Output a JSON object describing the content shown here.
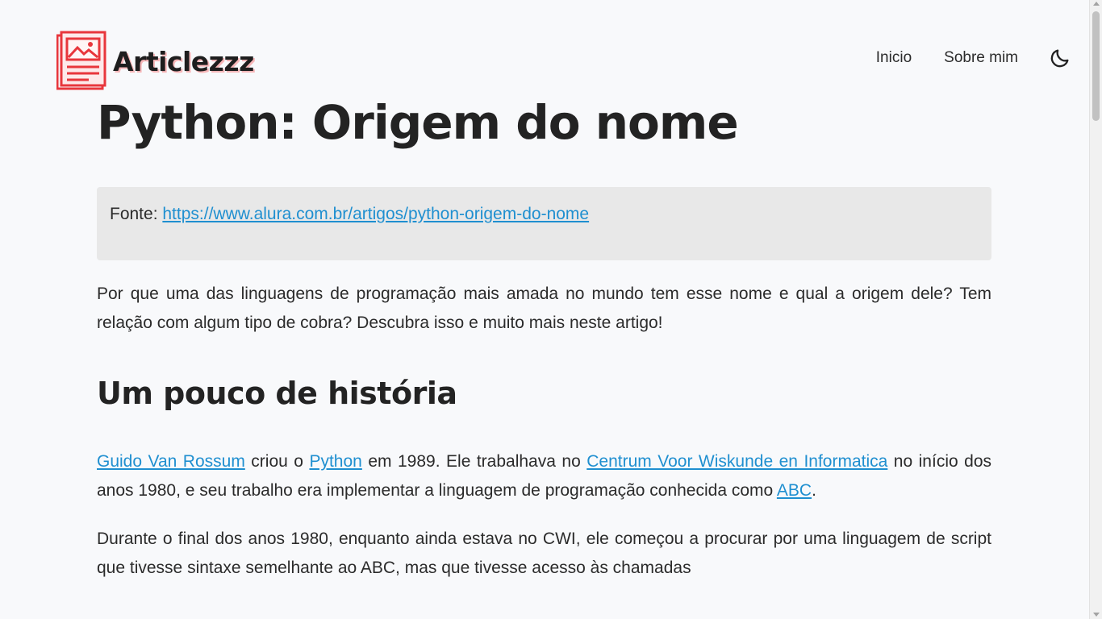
{
  "header": {
    "logo_text": "Articlezzz",
    "nav": [
      {
        "label": "Inicio"
      },
      {
        "label": "Sobre mim"
      }
    ],
    "theme_toggle_icon": "moon-icon"
  },
  "article": {
    "title": "Python: Origem do nome",
    "source": {
      "label": "Fonte: ",
      "url": "https://www.alura.com.br/artigos/python-origem-do-nome"
    },
    "intro": "Por que uma das linguagens de programação mais amada no mundo tem esse nome e qual a origem dele? Tem relação com algum tipo de cobra? Descubra isso e muito mais neste artigo!",
    "section_heading": "Um pouco de história",
    "p1": {
      "link1": "Guido Van Rossum",
      "t1": " criou o ",
      "link2": "Python",
      "t2": " em 1989. Ele trabalhava no ",
      "link3": "Centrum Voor Wiskunde en Informatica",
      "t3": " no início dos anos 1980, e seu trabalho era implementar a linguagem de programação conhecida como ",
      "link4": "ABC",
      "t4": "."
    },
    "p2": "Durante o final dos anos 1980, enquanto ainda estava no CWI, ele começou a procurar por uma linguagem de script que tivesse sintaxe semelhante ao ABC, mas que tivesse acesso às chamadas"
  },
  "colors": {
    "background": "#f8f9fb",
    "link": "#1f8fd0",
    "logo_red": "#e8363c",
    "source_box": "#e8e8e8"
  }
}
